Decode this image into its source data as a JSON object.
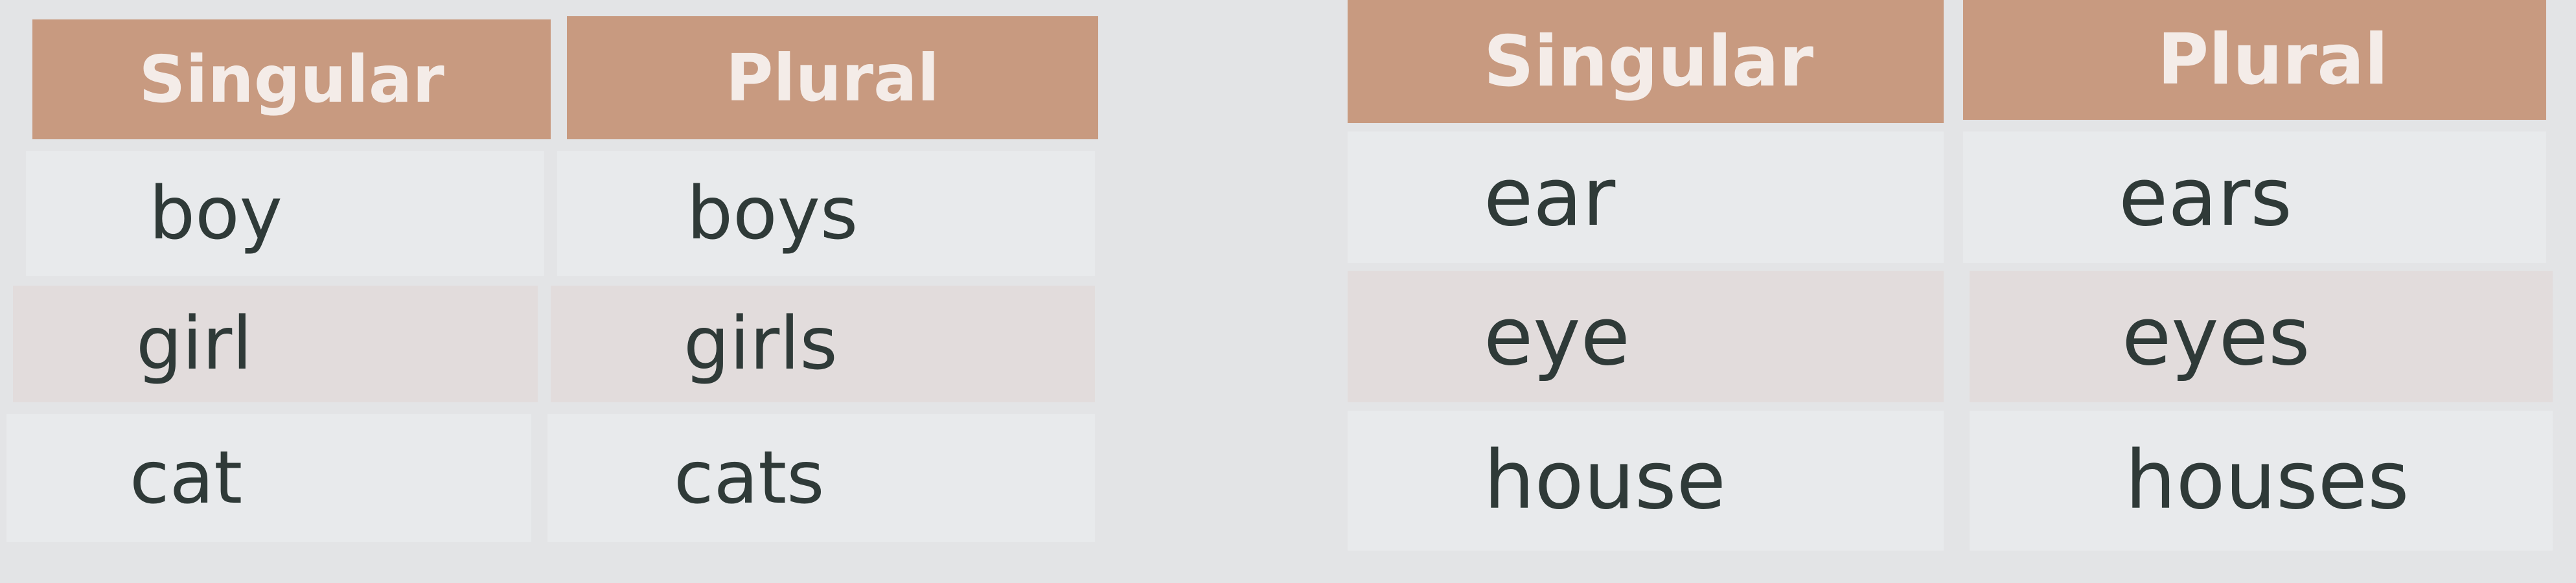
{
  "tables": [
    {
      "headers": [
        "Singular",
        "Plural"
      ],
      "rows": [
        [
          "boy",
          "boys"
        ],
        [
          "girl",
          "girls"
        ],
        [
          "cat",
          "cats"
        ]
      ]
    },
    {
      "headers": [
        "Singular",
        "Plural"
      ],
      "rows": [
        [
          "ear",
          "ears"
        ],
        [
          "eye",
          "eyes"
        ],
        [
          "house",
          "houses"
        ]
      ]
    }
  ],
  "colors": {
    "header": "#c89a80",
    "header_text": "#f4ece8",
    "text": "#2f3a38"
  }
}
